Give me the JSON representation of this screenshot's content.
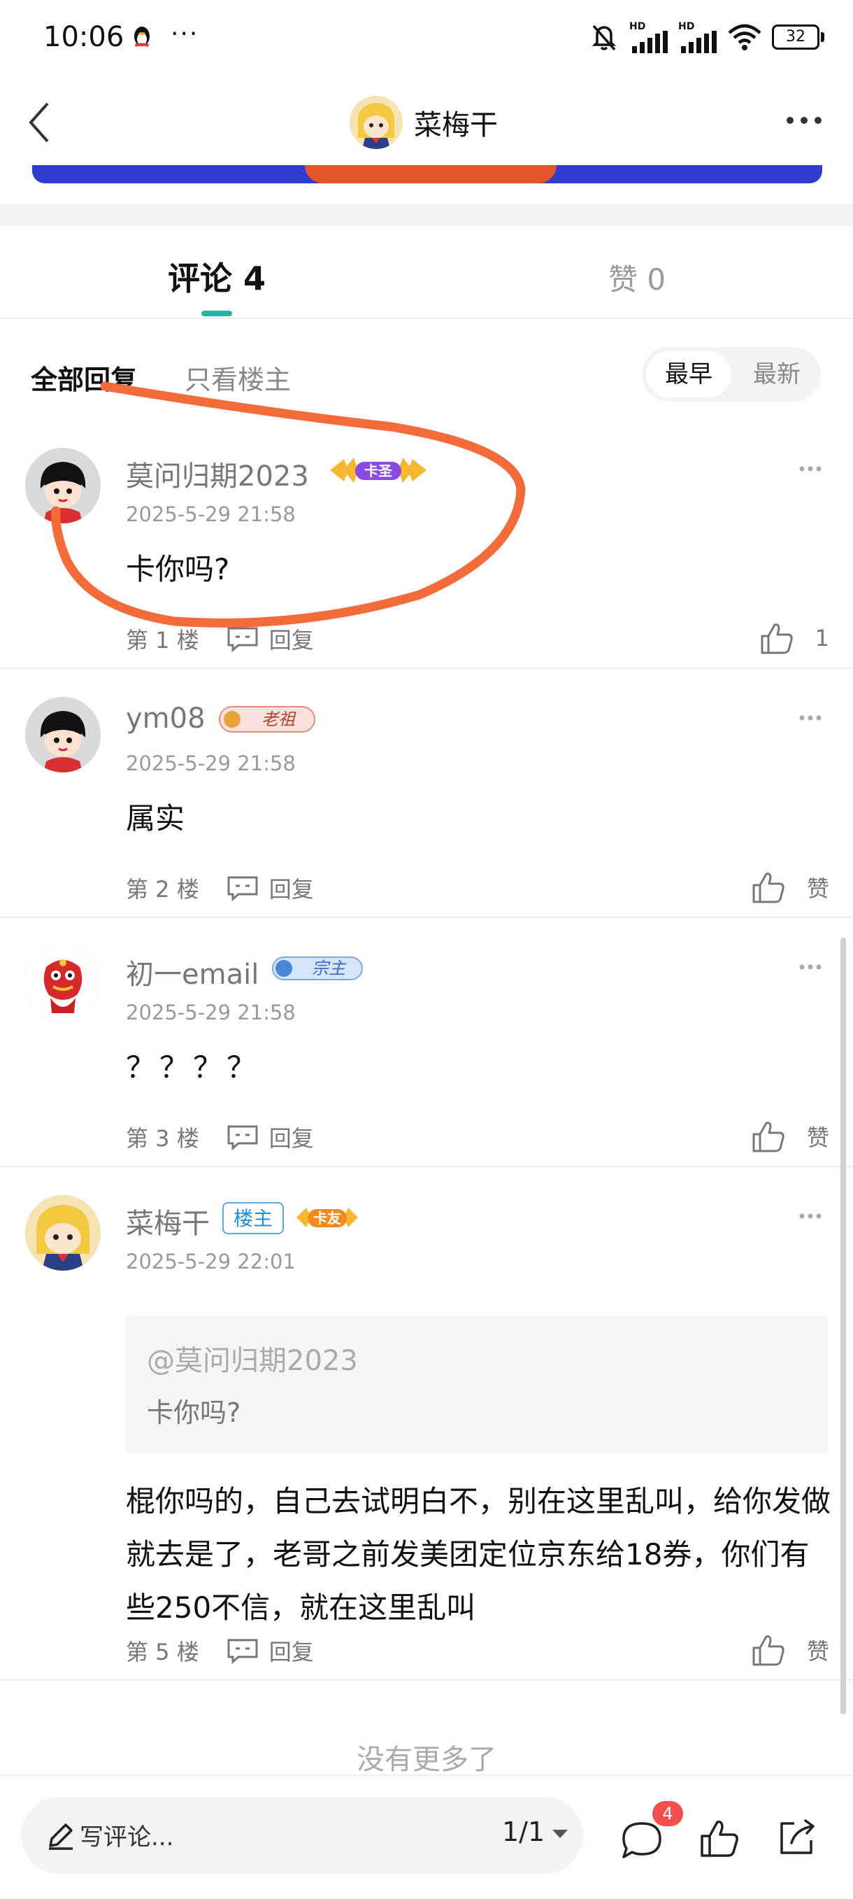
{
  "status_bar": {
    "time": "10:06",
    "more": "···",
    "battery": "32",
    "hd1": "HD",
    "hd2": "HD",
    "icons": [
      "qq-penguin-icon",
      "mute-bell-icon",
      "signal-icon",
      "signal-icon",
      "wifi-icon",
      "battery-icon"
    ]
  },
  "header": {
    "title": "菜梅干",
    "back_icon": "chevron-left-icon",
    "more_icon": "more-horizontal-icon"
  },
  "tabs": {
    "comments": "评论 4",
    "likes": "赞 0"
  },
  "filters": {
    "all": "全部回复",
    "owner_only": "只看楼主",
    "sort_earliest": "最早",
    "sort_newest": "最新"
  },
  "comments": [
    {
      "name": "莫问归期2023",
      "badge": "卡圣",
      "date": "2025-5-29 21:58",
      "text": "卡你吗?",
      "floor": "第 1 楼",
      "reply": "回复",
      "likes": "1"
    },
    {
      "name": "ym08",
      "badge": "老祖",
      "date": "2025-5-29 21:58",
      "text": "属实",
      "floor": "第 2 楼",
      "reply": "回复",
      "likes": "赞"
    },
    {
      "name": "初一email",
      "badge": "宗主",
      "date": "2025-5-29 21:58",
      "text": "？？？？",
      "floor": "第 3 楼",
      "reply": "回复",
      "likes": "赞"
    },
    {
      "name": "菜梅干",
      "owner_tag": "楼主",
      "badge": "卡友",
      "date": "2025-5-29 22:01",
      "quote_user": "@莫问归期2023",
      "quote_text": "卡你吗?",
      "text": "棍你吗的，自己去试明白不，别在这里乱叫，给你发做就去是了，老哥之前发美团定位京东给18券，你们有些250不信，就在这里乱叫",
      "floor": "第 5 楼",
      "reply": "回复",
      "likes": "赞"
    }
  ],
  "no_more": "没有更多了",
  "bottom_bar": {
    "placeholder": "写评论...",
    "page": "1/1",
    "comment_count": "4"
  },
  "colors": {
    "accent": "#21b5a4",
    "annotation": "#f26b38",
    "notification": "#f34e4e"
  }
}
